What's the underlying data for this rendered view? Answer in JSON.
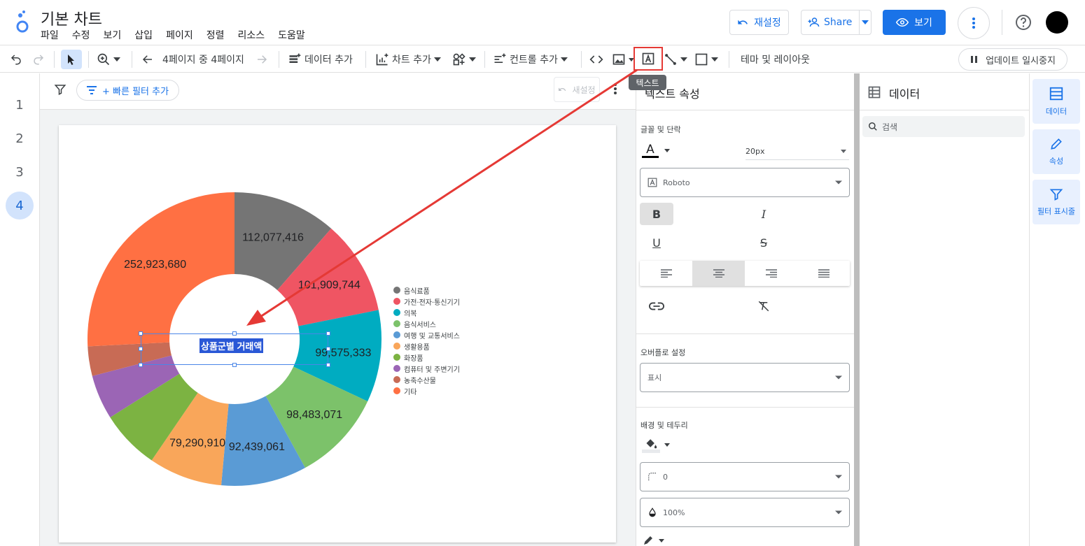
{
  "header": {
    "title": "기본 차트",
    "menu": [
      "파일",
      "수정",
      "보기",
      "삽입",
      "페이지",
      "정렬",
      "리소스",
      "도움말"
    ],
    "reset_label": "재설정",
    "share_label": "Share",
    "view_label": "보기"
  },
  "toolbar": {
    "page_indicator": "4페이지 중 4페이지",
    "add_data": "데이터 추가",
    "add_chart": "차트 추가",
    "add_control": "컨트롤 추가",
    "theme_layout": "테마 및 레이아웃",
    "pause_updates": "업데이트 일시중지",
    "tooltip": "텍스트"
  },
  "pages": [
    "1",
    "2",
    "3",
    "4"
  ],
  "active_page": "4",
  "filterbar": {
    "quick_filter": "+ 빠른 필터 추가",
    "reset": "새설정"
  },
  "textbox": {
    "text": "상품군별 거래액"
  },
  "chart_data": {
    "type": "pie",
    "donut": true,
    "categories": [
      "음식료품",
      "가전·전자·통신기기",
      "의복",
      "음식서비스",
      "여행 및 교통서비스",
      "생활용품",
      "화장품",
      "컴퓨터 및 주변기기",
      "농축수산물",
      "기타"
    ],
    "values": [
      112077416,
      101909744,
      99575333,
      98483071,
      92439061,
      79290910,
      64000000,
      48000000,
      32000000,
      252923680
    ],
    "labels": [
      "112,077,416",
      "101,909,744",
      "99,575,333",
      "98,483,071",
      "92,439,061",
      "79,290,910",
      "",
      "",
      "",
      "252,923,680"
    ],
    "colors": [
      "#757575",
      "#ef5563",
      "#00acc1",
      "#7cc26a",
      "#5a9bd5",
      "#f9a65a",
      "#7cb342",
      "#9b65b5",
      "#c86b55",
      "#ff7043"
    ],
    "legend_position": "right"
  },
  "props": {
    "title": "텍스트 속성",
    "font_section": "글꼴 및 단락",
    "font_size": "20px",
    "font_family": "Roboto",
    "overflow_section": "오버플로 설정",
    "overflow_value": "표시",
    "bg_section": "배경 및 테두리",
    "border_radius": "0",
    "opacity": "100%"
  },
  "datapanel": {
    "title": "데이터",
    "search_placeholder": "검색"
  },
  "rail": {
    "data": "데이터",
    "props": "속성",
    "filter": "필터 표시줄"
  }
}
